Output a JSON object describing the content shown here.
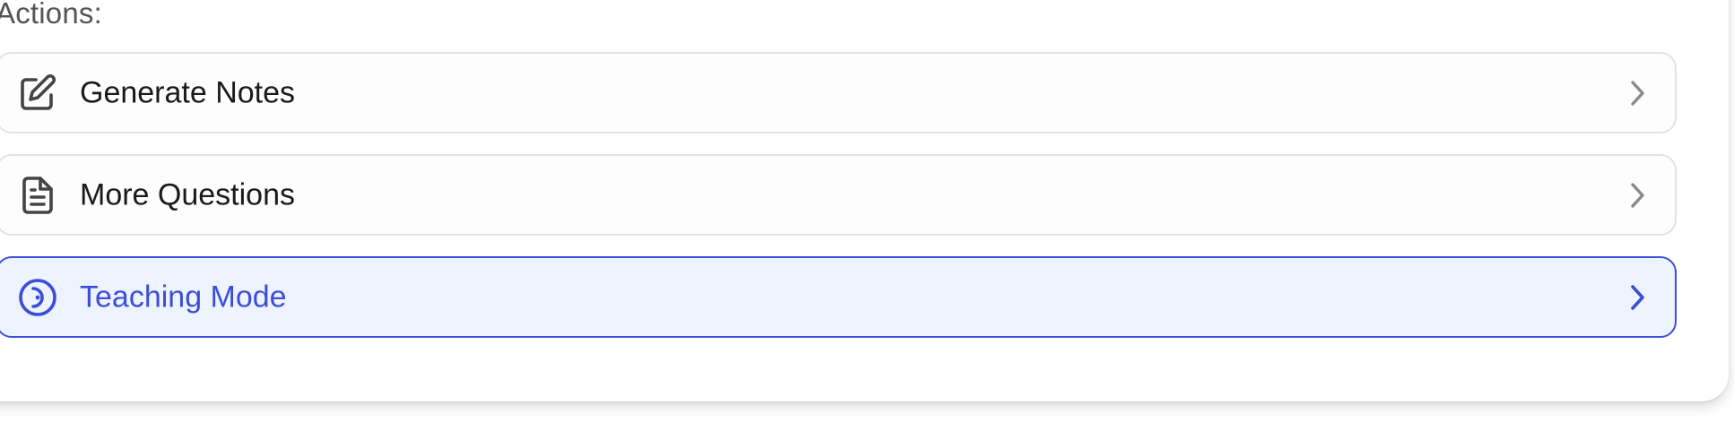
{
  "actions": {
    "title": "Actions:",
    "items": [
      {
        "label": "Generate Notes",
        "icon": "edit-note-icon",
        "active": false
      },
      {
        "label": "More Questions",
        "icon": "document-icon",
        "active": false
      },
      {
        "label": "Teaching Mode",
        "icon": "teaching-target-icon",
        "active": true
      }
    ]
  },
  "colors": {
    "accent": "#3c4ed8",
    "active_bg": "#eef4ff",
    "border": "#e2e2e2",
    "icon_gray": "#444444",
    "chevron_gray": "#8a8a8a"
  }
}
